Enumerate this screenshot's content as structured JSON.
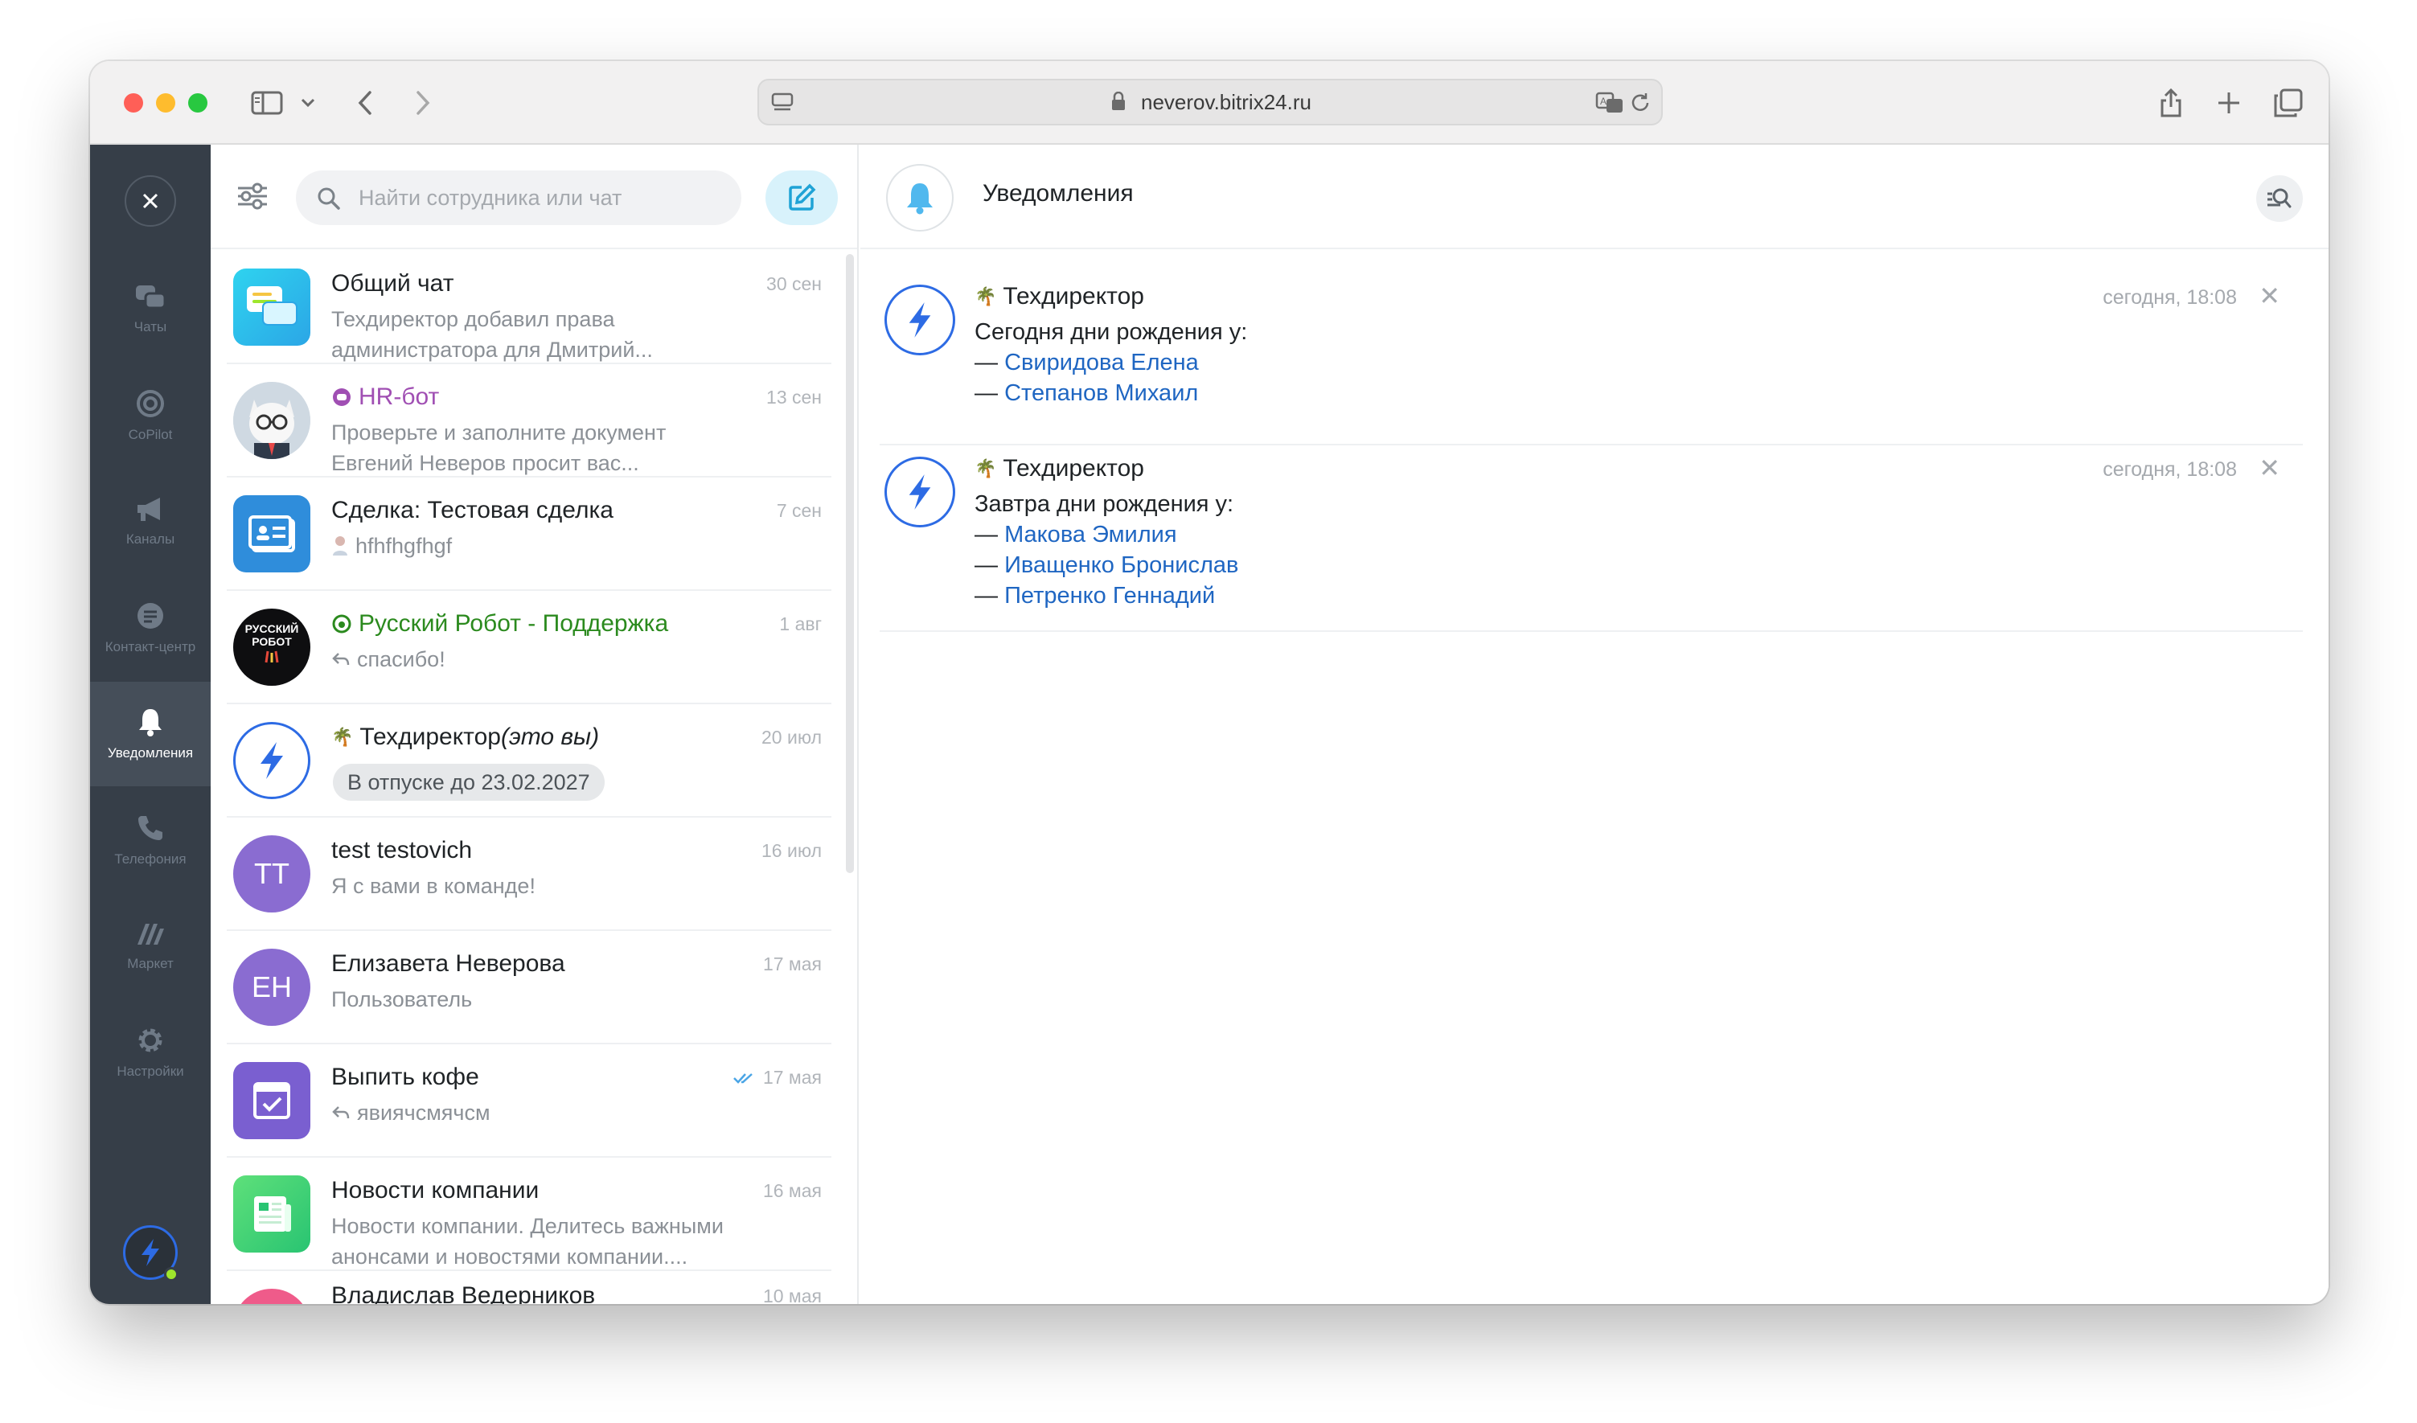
{
  "browser": {
    "url": "neverov.bitrix24.ru"
  },
  "nav": {
    "items": [
      {
        "label": "Чаты",
        "icon": "chats-icon"
      },
      {
        "label": "CoPilot",
        "icon": "copilot-icon"
      },
      {
        "label": "Каналы",
        "icon": "megaphone-icon"
      },
      {
        "label": "Контакт-центр",
        "icon": "contact-center-icon"
      },
      {
        "label": "Уведомления",
        "icon": "bell-icon",
        "active": true
      },
      {
        "label": "Телефония",
        "icon": "phone-icon"
      },
      {
        "label": "Маркет",
        "icon": "market-icon"
      },
      {
        "label": "Настройки",
        "icon": "gear-icon"
      }
    ]
  },
  "chatlist": {
    "search_placeholder": "Найти сотрудника или чат",
    "items": [
      {
        "title": "Общий чат",
        "date": "30 сен",
        "line1": "Техдиректор добавил права",
        "line2": "администратора для Дмитрий..."
      },
      {
        "title": "HR-бот",
        "date": "13 сен",
        "line1": "Проверьте и заполните документ",
        "line2": "Евгений Неверов просит вас..."
      },
      {
        "title": "Сделка: Тестовая сделка",
        "date": "7 сен",
        "line1": "hfhfhgfhgf"
      },
      {
        "title": "Русский Робот - Поддержка",
        "date": "1 авг",
        "line1": "спасибо!",
        "avatar_text1": "РУССКИЙ",
        "avatar_text2": "РОБОТ"
      },
      {
        "title": "Техдиректор",
        "title_suffix": "(это вы)",
        "date": "20 июл",
        "badge": "В отпуске до 23.02.2027"
      },
      {
        "title": "test testovich",
        "date": "16 июл",
        "line1": "Я с вами в команде!",
        "initials": "TT"
      },
      {
        "title": "Елизавета Неверова",
        "date": "17 мая",
        "line1": "Пользователь",
        "initials": "ЕН"
      },
      {
        "title": "Выпить кофе",
        "date": "17 мая",
        "line1": "явиячсмячсм"
      },
      {
        "title": "Новости компании",
        "date": "16 мая",
        "line1": "Новости компании. Делитесь важными",
        "line2": "анонсами и новостями компании...."
      },
      {
        "title": "Владислав Ведерников",
        "date": "10 мая"
      }
    ]
  },
  "panel": {
    "title": "Уведомления",
    "notifications": [
      {
        "author": "Техдиректор",
        "time": "сегодня, 18:08",
        "text": "Сегодня дни рождения у:",
        "names": [
          "Свиридова Елена",
          "Степанов Михаил"
        ]
      },
      {
        "author": "Техдиректор",
        "time": "сегодня, 18:08",
        "text": "Завтра дни рождения у:",
        "names": [
          "Макова Эмилия",
          "Иващенко Бронислав",
          "Петренко Геннадий"
        ]
      }
    ]
  },
  "colors": {
    "nav_bg": "#363e48",
    "link": "#1f66c2",
    "accent": "#2d6be4",
    "hr_bot": "#a04fb3",
    "robot_support": "#2b8a1e"
  }
}
